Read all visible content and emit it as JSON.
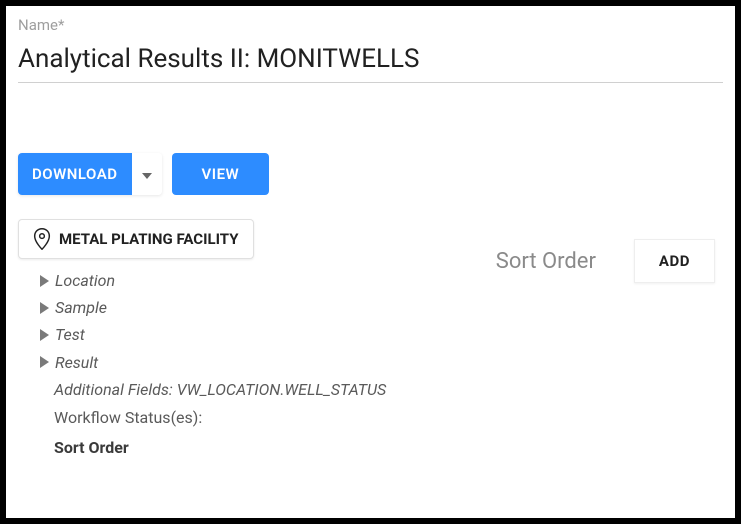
{
  "field": {
    "label": "Name*",
    "value": "Analytical Results II: MONITWELLS"
  },
  "buttons": {
    "download": "DOWNLOAD",
    "view": "VIEW",
    "add": "ADD"
  },
  "facility": {
    "name": "METAL PLATING FACILITY"
  },
  "tree": {
    "items": [
      {
        "label": "Location"
      },
      {
        "label": "Sample"
      },
      {
        "label": "Test"
      },
      {
        "label": "Result"
      }
    ]
  },
  "info": {
    "additional_fields": "Additional Fields: VW_LOCATION.WELL_STATUS",
    "workflow_statuses": "Workflow Status(es):",
    "sort_order_heading": "Sort Order"
  },
  "right": {
    "sort_label": "Sort Order"
  }
}
